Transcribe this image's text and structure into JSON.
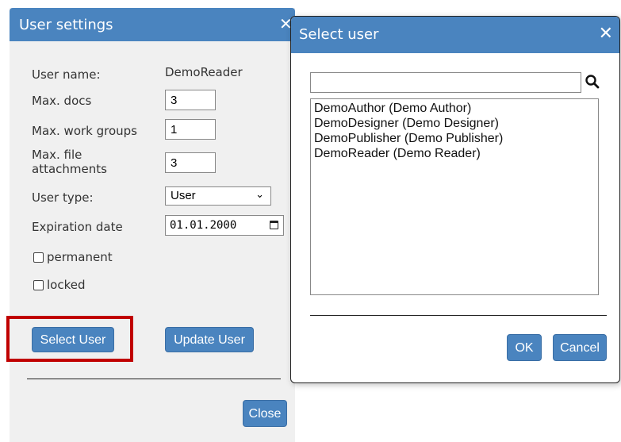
{
  "user_settings": {
    "title": "User settings",
    "close_glyph": "✕",
    "fields": {
      "user_name_label": "User name:",
      "user_name_value": "DemoReader",
      "max_docs_label": "Max. docs",
      "max_docs_value": "3",
      "max_groups_label": "Max. work groups",
      "max_groups_value": "1",
      "max_files_label_1": "Max. file",
      "max_files_label_2": "attachments",
      "max_files_value": "3",
      "user_type_label": "User type:",
      "user_type_value": "User",
      "expiration_label": "Expiration date",
      "expiration_value": "01.01.2000"
    },
    "permanent_label": "permanent",
    "locked_label": "locked",
    "select_user_button": "Select User",
    "update_user_button": "Update User",
    "close_button": "Close"
  },
  "select_user": {
    "title": "Select user",
    "close_glyph": "✕",
    "search_value": "",
    "users": [
      "DemoAuthor (Demo Author)",
      "DemoDesigner (Demo Designer)",
      "DemoPublisher (Demo Publisher)",
      "DemoReader (Demo Reader)"
    ],
    "ok_button": "OK",
    "cancel_button": "Cancel"
  },
  "icons": {
    "search": "search-icon",
    "calendar": "calendar-icon",
    "dropdown": "chevron-down-icon"
  },
  "colors": {
    "title_bar": "#4a84bf",
    "highlight": "#c00000"
  }
}
